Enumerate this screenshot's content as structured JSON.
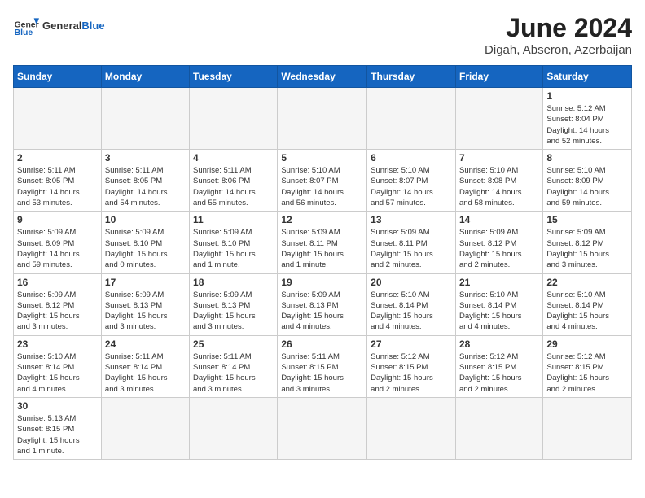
{
  "header": {
    "logo_general": "General",
    "logo_blue": "Blue",
    "month_title": "June 2024",
    "location": "Digah, Abseron, Azerbaijan"
  },
  "days_of_week": [
    "Sunday",
    "Monday",
    "Tuesday",
    "Wednesday",
    "Thursday",
    "Friday",
    "Saturday"
  ],
  "weeks": [
    [
      {
        "day": "",
        "info": ""
      },
      {
        "day": "",
        "info": ""
      },
      {
        "day": "",
        "info": ""
      },
      {
        "day": "",
        "info": ""
      },
      {
        "day": "",
        "info": ""
      },
      {
        "day": "",
        "info": ""
      },
      {
        "day": "1",
        "info": "Sunrise: 5:12 AM\nSunset: 8:04 PM\nDaylight: 14 hours\nand 52 minutes."
      }
    ],
    [
      {
        "day": "2",
        "info": "Sunrise: 5:11 AM\nSunset: 8:05 PM\nDaylight: 14 hours\nand 53 minutes."
      },
      {
        "day": "3",
        "info": "Sunrise: 5:11 AM\nSunset: 8:05 PM\nDaylight: 14 hours\nand 54 minutes."
      },
      {
        "day": "4",
        "info": "Sunrise: 5:11 AM\nSunset: 8:06 PM\nDaylight: 14 hours\nand 55 minutes."
      },
      {
        "day": "5",
        "info": "Sunrise: 5:10 AM\nSunset: 8:07 PM\nDaylight: 14 hours\nand 56 minutes."
      },
      {
        "day": "6",
        "info": "Sunrise: 5:10 AM\nSunset: 8:07 PM\nDaylight: 14 hours\nand 57 minutes."
      },
      {
        "day": "7",
        "info": "Sunrise: 5:10 AM\nSunset: 8:08 PM\nDaylight: 14 hours\nand 58 minutes."
      },
      {
        "day": "8",
        "info": "Sunrise: 5:10 AM\nSunset: 8:09 PM\nDaylight: 14 hours\nand 59 minutes."
      }
    ],
    [
      {
        "day": "9",
        "info": "Sunrise: 5:09 AM\nSunset: 8:09 PM\nDaylight: 14 hours\nand 59 minutes."
      },
      {
        "day": "10",
        "info": "Sunrise: 5:09 AM\nSunset: 8:10 PM\nDaylight: 15 hours\nand 0 minutes."
      },
      {
        "day": "11",
        "info": "Sunrise: 5:09 AM\nSunset: 8:10 PM\nDaylight: 15 hours\nand 1 minute."
      },
      {
        "day": "12",
        "info": "Sunrise: 5:09 AM\nSunset: 8:11 PM\nDaylight: 15 hours\nand 1 minute."
      },
      {
        "day": "13",
        "info": "Sunrise: 5:09 AM\nSunset: 8:11 PM\nDaylight: 15 hours\nand 2 minutes."
      },
      {
        "day": "14",
        "info": "Sunrise: 5:09 AM\nSunset: 8:12 PM\nDaylight: 15 hours\nand 2 minutes."
      },
      {
        "day": "15",
        "info": "Sunrise: 5:09 AM\nSunset: 8:12 PM\nDaylight: 15 hours\nand 3 minutes."
      }
    ],
    [
      {
        "day": "16",
        "info": "Sunrise: 5:09 AM\nSunset: 8:12 PM\nDaylight: 15 hours\nand 3 minutes."
      },
      {
        "day": "17",
        "info": "Sunrise: 5:09 AM\nSunset: 8:13 PM\nDaylight: 15 hours\nand 3 minutes."
      },
      {
        "day": "18",
        "info": "Sunrise: 5:09 AM\nSunset: 8:13 PM\nDaylight: 15 hours\nand 3 minutes."
      },
      {
        "day": "19",
        "info": "Sunrise: 5:09 AM\nSunset: 8:13 PM\nDaylight: 15 hours\nand 4 minutes."
      },
      {
        "day": "20",
        "info": "Sunrise: 5:10 AM\nSunset: 8:14 PM\nDaylight: 15 hours\nand 4 minutes."
      },
      {
        "day": "21",
        "info": "Sunrise: 5:10 AM\nSunset: 8:14 PM\nDaylight: 15 hours\nand 4 minutes."
      },
      {
        "day": "22",
        "info": "Sunrise: 5:10 AM\nSunset: 8:14 PM\nDaylight: 15 hours\nand 4 minutes."
      }
    ],
    [
      {
        "day": "23",
        "info": "Sunrise: 5:10 AM\nSunset: 8:14 PM\nDaylight: 15 hours\nand 4 minutes."
      },
      {
        "day": "24",
        "info": "Sunrise: 5:11 AM\nSunset: 8:14 PM\nDaylight: 15 hours\nand 3 minutes."
      },
      {
        "day": "25",
        "info": "Sunrise: 5:11 AM\nSunset: 8:14 PM\nDaylight: 15 hours\nand 3 minutes."
      },
      {
        "day": "26",
        "info": "Sunrise: 5:11 AM\nSunset: 8:15 PM\nDaylight: 15 hours\nand 3 minutes."
      },
      {
        "day": "27",
        "info": "Sunrise: 5:12 AM\nSunset: 8:15 PM\nDaylight: 15 hours\nand 2 minutes."
      },
      {
        "day": "28",
        "info": "Sunrise: 5:12 AM\nSunset: 8:15 PM\nDaylight: 15 hours\nand 2 minutes."
      },
      {
        "day": "29",
        "info": "Sunrise: 5:12 AM\nSunset: 8:15 PM\nDaylight: 15 hours\nand 2 minutes."
      }
    ],
    [
      {
        "day": "30",
        "info": "Sunrise: 5:13 AM\nSunset: 8:15 PM\nDaylight: 15 hours\nand 1 minute."
      },
      {
        "day": "",
        "info": ""
      },
      {
        "day": "",
        "info": ""
      },
      {
        "day": "",
        "info": ""
      },
      {
        "day": "",
        "info": ""
      },
      {
        "day": "",
        "info": ""
      },
      {
        "day": "",
        "info": ""
      }
    ]
  ]
}
